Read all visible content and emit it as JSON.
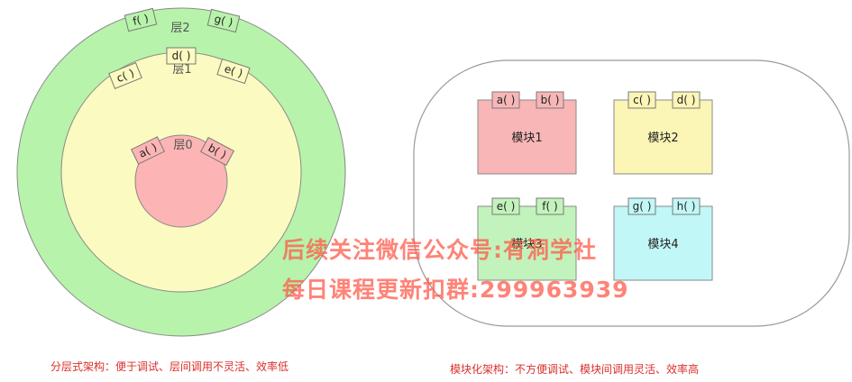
{
  "layered": {
    "layer2": {
      "label": "层2",
      "functions": [
        "f( )",
        "g( )"
      ]
    },
    "layer1": {
      "label": "层1",
      "functions": [
        "d( )",
        "c( )",
        "e( )"
      ]
    },
    "layer0": {
      "label": "层0",
      "functions": [
        "a( )",
        "b( )"
      ]
    },
    "caption": "分层式架构：便于调试、层间调用不灵活、效率低"
  },
  "modular": {
    "modules": [
      {
        "name": "模块1",
        "functions": [
          "a( )",
          "b( )"
        ],
        "color": "#f8b6b6"
      },
      {
        "name": "模块2",
        "functions": [
          "c( )",
          "d( )"
        ],
        "color": "#fbf5b6"
      },
      {
        "name": "模块3",
        "functions": [
          "e( )",
          "f( )"
        ],
        "color": "#c3f3bc"
      },
      {
        "name": "模块4",
        "functions": [
          "g( )",
          "h( )"
        ],
        "color": "#c2f7f7"
      }
    ],
    "caption": "模块化架构：不方便调试、模块间调用灵活、效率高"
  },
  "watermark": {
    "line1": "后续关注微信公众号:有洞学社",
    "line2": "每日课程更新扣群:299963939"
  },
  "colors": {
    "layer2_fill": "#b7f3ab",
    "layer1_fill": "#fbfac0",
    "layer0_fill": "#fcb4b4",
    "outline": "#8a8a8a",
    "caption": "#d9302c",
    "watermark": "#ff5a4a"
  }
}
